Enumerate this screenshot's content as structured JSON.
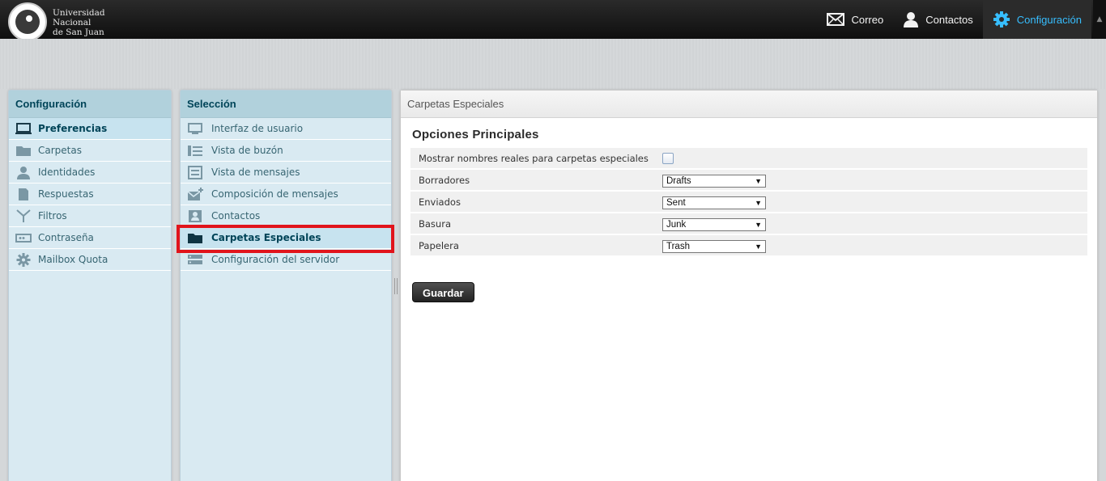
{
  "header": {
    "logo_text_line1": "Universidad",
    "logo_text_line2": "Nacional",
    "logo_text_line3": "de San Juan",
    "nav": [
      {
        "label": "Correo",
        "icon": "envelope-icon"
      },
      {
        "label": "Contactos",
        "icon": "user-icon"
      },
      {
        "label": "Configuración",
        "icon": "gear-icon",
        "active": true
      }
    ],
    "accent_color": "#37beff"
  },
  "config_panel": {
    "title": "Configuración",
    "items": [
      {
        "label": "Preferencias",
        "icon": "monitor-icon",
        "selected": true
      },
      {
        "label": "Carpetas",
        "icon": "folder-icon"
      },
      {
        "label": "Identidades",
        "icon": "person-icon"
      },
      {
        "label": "Respuestas",
        "icon": "document-icon"
      },
      {
        "label": "Filtros",
        "icon": "filter-icon"
      },
      {
        "label": "Contraseña",
        "icon": "password-icon"
      },
      {
        "label": "Mailbox Quota",
        "icon": "gear-icon"
      }
    ]
  },
  "selection_panel": {
    "title": "Selección",
    "items": [
      {
        "label": "Interfaz de usuario",
        "icon": "monitor-icon"
      },
      {
        "label": "Vista de buzón",
        "icon": "mailbox-view-icon"
      },
      {
        "label": "Vista de mensajes",
        "icon": "message-view-icon"
      },
      {
        "label": "Composición de mensajes",
        "icon": "compose-icon"
      },
      {
        "label": "Contactos",
        "icon": "contacts-icon"
      },
      {
        "label": "Carpetas Especiales",
        "icon": "folder-icon",
        "selected": true
      },
      {
        "label": "Configuración del servidor",
        "icon": "server-icon"
      }
    ]
  },
  "content": {
    "header": "Carpetas Especiales",
    "section_title": "Opciones Principales",
    "options": [
      {
        "label": "Mostrar nombres reales para carpetas especiales",
        "type": "checkbox",
        "checked": false
      },
      {
        "label": "Borradores",
        "type": "select",
        "value": "Drafts"
      },
      {
        "label": "Enviados",
        "type": "select",
        "value": "Sent"
      },
      {
        "label": "Basura",
        "type": "select",
        "value": "Junk"
      },
      {
        "label": "Papelera",
        "type": "select",
        "value": "Trash"
      }
    ],
    "save_label": "Guardar"
  },
  "highlight_color": "#e1141b"
}
